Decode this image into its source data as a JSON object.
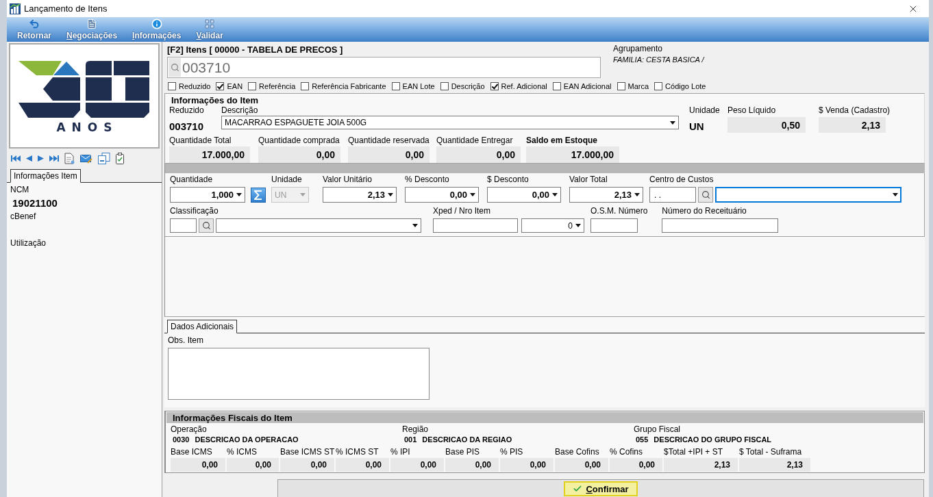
{
  "window": {
    "title": "Lançamento de Itens"
  },
  "toolbar": [
    {
      "label": "Retornar",
      "mnemonic": false
    },
    {
      "label": "Negociações",
      "mnemonic": true
    },
    {
      "label": "Informações",
      "mnemonic": true
    },
    {
      "label": "Validar",
      "mnemonic": true
    }
  ],
  "logo": {
    "caption": "ANOS"
  },
  "side_tab": {
    "label": "Informações Item",
    "selected": true
  },
  "side_fields": [
    {
      "label": "NCM",
      "value": "19021100"
    },
    {
      "label": "cBenef"
    },
    {
      "label": "Utilização"
    }
  ],
  "search": {
    "title": "[F2] Itens [ 00000 - TABELA DE PRECOS ]",
    "value": "003710"
  },
  "grouping": {
    "label": "Agrupamento",
    "value": "FAMILIA: CESTA BASICA /"
  },
  "search_options": [
    {
      "label": "Reduzido",
      "checked": false
    },
    {
      "label": "EAN",
      "checked": true
    },
    {
      "label": "Referência",
      "checked": false
    },
    {
      "label": "Referência Fabricante",
      "checked": false
    },
    {
      "label": "EAN Lote",
      "checked": false
    },
    {
      "label": "Descrição",
      "checked": false
    },
    {
      "label": "Ref. Adicional",
      "checked": true
    },
    {
      "label": "EAN Adicional",
      "checked": false
    },
    {
      "label": "Marca",
      "checked": false
    },
    {
      "label": "Código Lote",
      "checked": false
    }
  ],
  "item_info": {
    "title": "Informações do Item",
    "code_label": "Reduzido",
    "code": "003710",
    "description_label": "Descrição",
    "description": "MACARRAO ESPAGUETE JOIA 500G",
    "unit_label": "Unidade",
    "unit": "UN",
    "figures": [
      {
        "label": "Peso Líquido",
        "value": "0,50"
      },
      {
        "label": "$ Venda (Cadastro)",
        "value": "2,13"
      }
    ],
    "stock": [
      {
        "label": "Quantidade Total",
        "value": "17.000,00",
        "emphasis": false
      },
      {
        "label": "Quantidade comprada",
        "value": "0,00",
        "emphasis": false
      },
      {
        "label": "Quantidade reservada",
        "value": "0,00",
        "emphasis": false
      },
      {
        "label": "Quantidade Entregar",
        "value": "0,00",
        "emphasis": false
      },
      {
        "label": "Saldo em Estoque",
        "value": "17.000,00",
        "emphasis": true
      }
    ]
  },
  "entry_rows": [
    [
      {
        "kind": "combo",
        "label": "Quantidade",
        "value": "1,000",
        "disabled": false,
        "sum": true
      },
      {
        "kind": "combo",
        "label": "Unidade",
        "value": "UN",
        "disabled": true,
        "sum": false
      },
      {
        "kind": "combo",
        "label": "Valor Unitário",
        "value": "2,13",
        "disabled": false,
        "sum": false
      },
      {
        "kind": "combo",
        "label": "% Desconto",
        "value": "0,00",
        "disabled": false,
        "sum": false
      },
      {
        "kind": "combo",
        "label": "$ Desconto",
        "value": "0,00",
        "disabled": false,
        "sum": false
      },
      {
        "kind": "combo",
        "label": "Valor Total",
        "value": "2,13",
        "disabled": false,
        "sum": false
      },
      {
        "kind": "lookup",
        "label": "Centro de Custos",
        "value": ". .",
        "focused": true
      }
    ],
    [
      {
        "kind": "lookup",
        "label": "Classificação",
        "focused": false
      },
      {
        "kind": "pair",
        "label": "Xped / Nro Item",
        "value": "0"
      },
      {
        "kind": "text",
        "label": "O.S.M. Número"
      },
      {
        "kind": "text",
        "label": "Número do Receituário"
      }
    ]
  ],
  "additional": {
    "tab": {
      "label": "Dados Adicionais",
      "selected": true
    },
    "obs_label": "Obs. Item"
  },
  "fiscal": {
    "title": "Informações Fiscais do Item",
    "groups": [
      {
        "label": "Operação",
        "code": "0030",
        "description": "DESCRICAO DA OPERACAO"
      },
      {
        "label": "Região",
        "code": "001",
        "description": "DESCRICAO DA REGIAO"
      },
      {
        "label": "Grupo Fiscal",
        "code": "055",
        "description": "DESCRICAO DO GRUPO FISCAL"
      }
    ],
    "values": [
      {
        "label": "Base ICMS",
        "value": "0,00"
      },
      {
        "label": "% ICMS",
        "value": "0,00"
      },
      {
        "label": "Base ICMS ST",
        "value": "0,00"
      },
      {
        "label": "% ICMS ST",
        "value": "0,00"
      },
      {
        "label": "% IPI",
        "value": "0,00"
      },
      {
        "label": "Base PIS",
        "value": "0,00"
      },
      {
        "label": "% PIS",
        "value": "0,00"
      },
      {
        "label": "Base Cofins",
        "value": "0,00"
      },
      {
        "label": "% Cofins",
        "value": "0,00"
      },
      {
        "label": "$Total +IPI + ST",
        "value": "2,13"
      },
      {
        "label": "$ Total - Suframa",
        "value": "2,13"
      }
    ]
  },
  "confirm": {
    "label": "Confirmar",
    "mnemonic": true
  }
}
